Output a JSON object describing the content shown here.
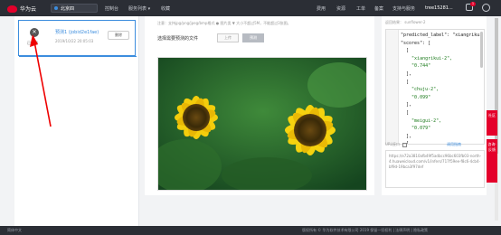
{
  "topbar": {
    "brand": "华为云",
    "region": "北京四",
    "nav": [
      "控制台",
      "服务列表 ▾",
      "收藏"
    ],
    "right": [
      "费用",
      "资源",
      "工单",
      "备案",
      "支持与服务"
    ],
    "user": "tree15281...",
    "badge": "1"
  },
  "job": {
    "status": "已取消",
    "name": "预测1 (jobid2e1fae)",
    "time": "2019/10/22 20:05:03",
    "delete_label": "删除"
  },
  "center": {
    "hint": "注意：支持jpg/png/jpeg/bmp格式 ● 图片类 ▼ 大小不超过5M，不能超过3张图。",
    "upload_prompt": "选择需要预测的文件",
    "upload_button": "上传",
    "predict_button": "预测"
  },
  "result": {
    "label": "返回结果： sunflower-2",
    "lines": [
      "\"predicted_label\": \"xiangrikui",
      "\"scores\": [",
      "  [",
      "    \"xiangrikui-2\",",
      "    \"0.744\"",
      "  ],",
      "  [",
      "    \"chuju-2\",",
      "    \"0.099\"",
      "  ],",
      "  [",
      "    \"meigui-2\",",
      "    \"0.079\"",
      "  ],",
      "  ["
    ]
  },
  "url": {
    "label": "URL接口",
    "api_link": "调用指南",
    "value": "https://e72a3810afb49f5adbcc96bc603fb03-north-4.huaweicloud.com/v1/infers/717f59ee-f8c6-4cb4-bf9d-19bca3f97def"
  },
  "side": {
    "btn1": "社区",
    "btn2": "咨询·反馈"
  },
  "footer": {
    "lang": "简体中文",
    "copyright": "版权所有 © 华为软件技术有限公司 2019 保留一切权利   |   法律声明   |   隐私政策"
  }
}
